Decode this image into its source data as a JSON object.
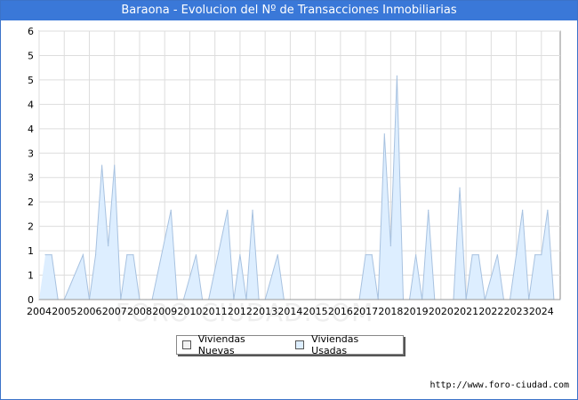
{
  "title": "Baraona - Evolucion del Nº de Transacciones Inmobiliarias",
  "watermark": "FORO-CIUDAD.COM",
  "url": "http://www.foro-ciudad.com",
  "legend": {
    "nuevas": "Viviendas Nuevas",
    "usadas": "Viviendas Usadas"
  },
  "colors": {
    "title_bg": "#3a78d8",
    "usadas_fill": "#ddeeff",
    "usadas_line": "#a8c2e0",
    "nuevas_fill": "#f2f2f2",
    "grid": "#dddddd"
  },
  "chart_data": {
    "type": "area",
    "title": "Baraona - Evolucion del Nº de Transacciones Inmobiliarias",
    "xlabel": "",
    "ylabel": "",
    "xlim": [
      2004,
      2024.75
    ],
    "ylim": [
      0,
      6
    ],
    "x_ticks": [
      "2004",
      "2005",
      "2006",
      "2007",
      "2008",
      "2009",
      "2010",
      "2011",
      "2012",
      "2013",
      "2014",
      "2015",
      "2016",
      "2017",
      "2018",
      "2019",
      "2020",
      "2021",
      "2022",
      "2023",
      "2024"
    ],
    "y_ticks": [
      "0",
      "1",
      "1",
      "2",
      "2",
      "3",
      "3",
      "4",
      "4",
      "5",
      "5",
      "6"
    ],
    "grid": true,
    "legend_position": "bottom",
    "series": [
      {
        "name": "Viviendas Usadas",
        "x": [
          2004.25,
          2004.5,
          2004.75,
          2005.0,
          2005.75,
          2006.0,
          2006.25,
          2006.5,
          2006.75,
          2007.0,
          2007.25,
          2007.5,
          2007.75,
          2008.0,
          2008.25,
          2008.5,
          2009.25,
          2009.5,
          2009.75,
          2010.25,
          2010.5,
          2010.75,
          2011.5,
          2011.75,
          2012.0,
          2012.25,
          2012.5,
          2012.75,
          2013.0,
          2013.5,
          2013.75,
          2014.0,
          2016.75,
          2017.0,
          2017.25,
          2017.5,
          2017.75,
          2018.0,
          2018.25,
          2018.5,
          2018.75,
          2019.0,
          2019.25,
          2019.5,
          2019.75,
          2020.5,
          2020.75,
          2021.0,
          2021.25,
          2021.5,
          2021.75,
          2022.25,
          2022.5,
          2022.75,
          2023.0,
          2023.25,
          2023.5,
          2023.75,
          2024.0,
          2024.25,
          2024.5,
          2024.75
        ],
        "y": [
          1,
          1,
          0,
          0,
          1,
          0,
          1,
          3,
          1.2,
          3,
          0,
          1,
          1,
          0,
          0,
          0,
          2,
          0,
          0,
          1,
          0,
          0,
          2,
          0,
          1,
          0,
          2,
          0,
          0,
          1,
          0,
          0,
          0,
          1,
          1,
          0,
          3.7,
          1.2,
          5,
          0,
          0,
          1,
          0,
          2,
          0,
          0,
          2.5,
          0,
          1,
          1,
          0,
          1,
          0,
          0,
          1,
          2,
          0,
          1,
          1,
          2,
          0,
          0
        ]
      },
      {
        "name": "Viviendas Nuevas",
        "x": [
          2004,
          2024.75
        ],
        "y": [
          0,
          0
        ]
      }
    ]
  }
}
